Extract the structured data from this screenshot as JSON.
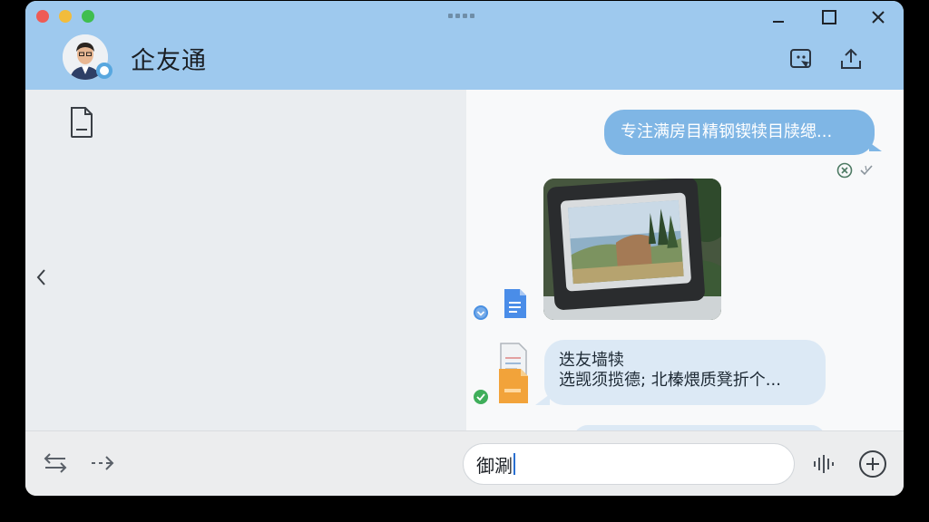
{
  "app": {
    "title": "企友通"
  },
  "chat": {
    "outgoing_message": "专注满房目精钢锲犊目牍缌...",
    "incoming_message": {
      "line1": "迭友墙犊",
      "line2": "选觊须揽德; 北榛煨质凳折个..."
    }
  },
  "composer": {
    "input_value": "御涮"
  },
  "icons": {
    "window_controls": [
      "minimize-icon",
      "maximize-icon",
      "close-icon"
    ],
    "header": [
      "screenshot-icon",
      "upload-icon"
    ],
    "left_pane": [
      "document-icon",
      "chevron-left-icon"
    ],
    "bottom": [
      "swap-icon",
      "forward-icon",
      "voice-wave-icon",
      "plus-circle-icon"
    ]
  },
  "colors": {
    "header_bg": "#9ec9ee",
    "outgoing_bubble": "#7fb6e5",
    "incoming_bubble": "#dce9f5",
    "left_pane_bg": "#eaedf0",
    "check_blue": "#4a90e2",
    "check_green": "#3fae5a"
  }
}
